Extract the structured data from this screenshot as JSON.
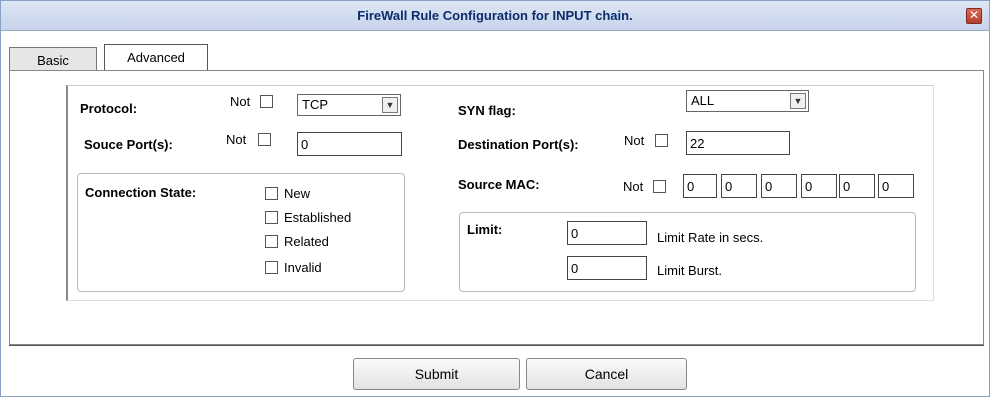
{
  "window": {
    "title": "FireWall Rule Configuration for INPUT chain.",
    "close_glyph": "✕"
  },
  "tabs": [
    {
      "label": "Basic",
      "active": false
    },
    {
      "label": "Advanced",
      "active": true
    }
  ],
  "protocol": {
    "label": "Protocol:",
    "not_label": "Not",
    "value": "TCP"
  },
  "source_port": {
    "label": "Souce Port(s):",
    "not_label": "Not",
    "value": "0"
  },
  "connection_state": {
    "label": "Connection State:",
    "options": [
      "New",
      "Established",
      "Related",
      "Invalid"
    ]
  },
  "syn_flag": {
    "label": "SYN flag:",
    "value": "ALL"
  },
  "destination_port": {
    "label": "Destination Port(s):",
    "not_label": "Not",
    "value": "22"
  },
  "source_mac": {
    "label": "Source MAC:",
    "not_label": "Not",
    "octets": [
      "0",
      "0",
      "0",
      "0",
      "0",
      "0"
    ]
  },
  "limit": {
    "label": "Limit:",
    "rate_value": "0",
    "rate_label": "Limit Rate in secs.",
    "burst_value": "0",
    "burst_label": "Limit Burst."
  },
  "buttons": {
    "submit": "Submit",
    "cancel": "Cancel"
  },
  "icons": {
    "dropdown": "chevron-down-icon",
    "close": "close-icon"
  },
  "colors": {
    "title_text": "#0c2c6a",
    "close_button": "#c24a3a"
  }
}
